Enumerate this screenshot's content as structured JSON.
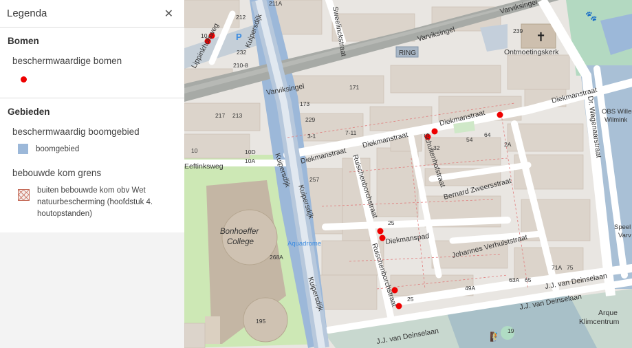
{
  "legend": {
    "title": "Legenda",
    "close_icon": "close-icon",
    "sections": [
      {
        "title": "Bomen",
        "layers": [
          {
            "title": "beschermwaardige bomen",
            "items": [
              {
                "symbol": "red-dot",
                "color": "#ee0000",
                "label": ""
              }
            ]
          }
        ]
      },
      {
        "title": "Gebieden",
        "layers": [
          {
            "title": "beschermwaardig boomgebied",
            "items": [
              {
                "symbol": "blue-square",
                "color": "#9cb8d9",
                "label": "boomgebied"
              }
            ]
          },
          {
            "title": "bebouwde kom grens",
            "items": [
              {
                "symbol": "hatched-square",
                "color": "#c46a58",
                "label": "buiten bebouwde kom obv Wet natuurbescherming (hoofdstuk 4. houtopstanden)"
              }
            ]
          }
        ]
      }
    ]
  },
  "map": {
    "streets": {
      "varviksingel_a": "Varviksingel",
      "varviksingel_b": "Varviksingel",
      "varviksingel_c": "Varviksingel",
      "ring": "RING",
      "sweelinckstraat": "Sweelinckstraat",
      "lippinkhofsweg": "Lippinkhofsweg",
      "kuipersdijk_a": "Kuipersdijk",
      "kuipersdijk_b": "Kuipersdijk",
      "kuipersdijk_c": "Kuipersdijk",
      "kuipersdijk_d": "Kuipersdijk",
      "eeftinksweg": "Eeftinksweg",
      "diekmanstraat_a": "Diekmanstraat",
      "diekmanstraat_b": "Diekmanstraat",
      "diekmanstraat_c": "Diekmanstraat",
      "diekmanstraat_d": "Diekmanstraat",
      "diekmanpad": "Diekmanspad",
      "schultenhofstraat": "Schultenhofstraat",
      "ruischenborchstraat_a": "Ruischenborchstraat",
      "ruischenborchstraat_b": "Ruischenborchstraat",
      "bernard_zweers": "Bernard Zweersstraat",
      "johannes_verhulst": "Johannes Verhulststraat",
      "jj_van_deinselaan_a": "J.J. van Deinselaan",
      "jj_van_deinselaan_b": "J.J. van Deinselaan",
      "jj_van_deinselaan_c": "J.J. van Deinselaan",
      "dr_wagenaarstraat": "Dr. Wagenaarstraat"
    },
    "pois": {
      "church": "Ontmoetingskerk",
      "school_line1": "Bonhoeffer",
      "school_line2": "College",
      "aquadrome": "Aquadrome",
      "obs_line1": "OBS Willem",
      "obs_line2": "Wilmink",
      "speel_line1": "Speel",
      "speel_line2": "Varv",
      "arque_line1": "Arque",
      "arque_line2": "Klimcentrum"
    },
    "house_numbers": {
      "n211a": "211A",
      "n211": "211",
      "n212": "212",
      "n232": "232",
      "n210": "210-8",
      "n10a": "10",
      "n239": "239",
      "n171": "171",
      "n173": "173",
      "n217": "217",
      "n213": "213",
      "n229": "229",
      "n3_1": "3-1",
      "n7_11": "7-11",
      "n10b": "10",
      "n10d": "10D",
      "n10a2": "10A",
      "n257": "257",
      "n268a": "268A",
      "n195": "195",
      "n25a": "25",
      "n25b": "25",
      "n54": "54",
      "n64": "64",
      "n2a": "2A",
      "n32": "32",
      "n71a": "71A",
      "n75": "75",
      "n63a": "63A",
      "n65": "65",
      "n49a": "49A",
      "n19": "19"
    },
    "icons": {
      "parking": "P"
    },
    "trees_color": "#ee0000"
  }
}
